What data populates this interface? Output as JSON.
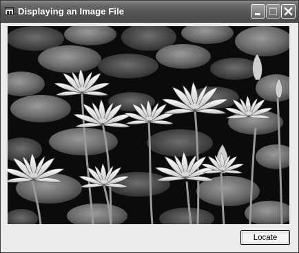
{
  "window": {
    "title": "Displaying an Image File"
  },
  "titlebar": {
    "buttons": [
      "minimize",
      "maximize",
      "close"
    ]
  },
  "main": {
    "picture": "water-lily-photo",
    "locate_label": "Locate"
  },
  "icons": {
    "app": "form-icon",
    "minimize": "minimize-icon",
    "maximize": "maximize-icon",
    "close": "close-icon"
  }
}
